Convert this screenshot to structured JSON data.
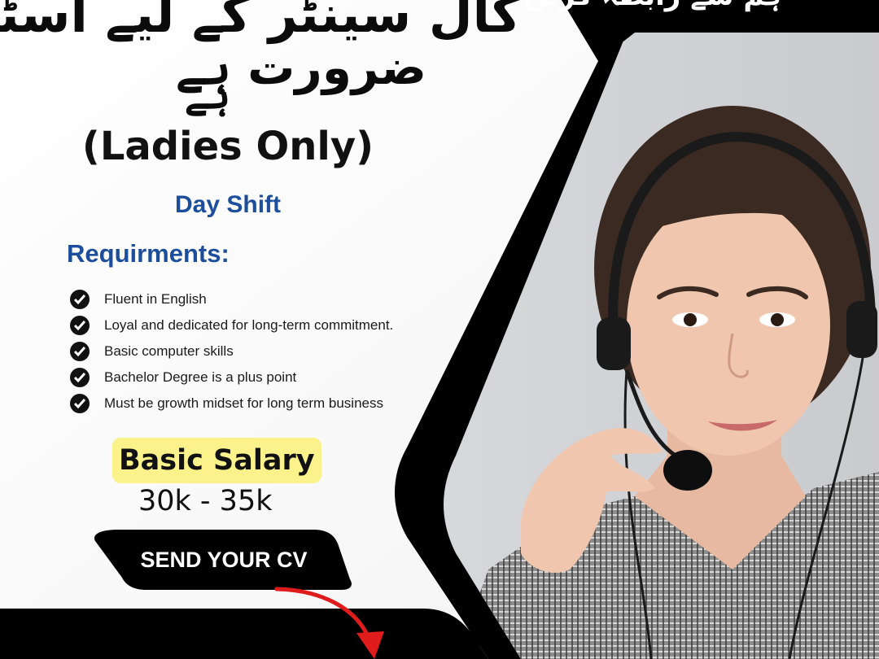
{
  "poster": {
    "urdu_headline_line1": "کال سینٹر کے لیے اسٹاف کی",
    "urdu_headline_line2": "ضرورت ہے",
    "urdu_headline_line3": "ہے",
    "urdu_top_right": "ہم سے رابطہ کریں",
    "ladies_only": "(Ladies Only)",
    "shift": "Day Shift",
    "requirements_heading": "Requirments:",
    "requirements": [
      "Fluent in English",
      "Loyal and dedicated for long-term commitment.",
      "Basic computer skills",
      "Bachelor Degree is a plus point",
      "Must be growth midset for long term business"
    ],
    "salary_label": "Basic Salary",
    "salary_range": "30k - 35k",
    "cta_label": "SEND YOUR CV"
  },
  "colors": {
    "accent_blue": "#1d4e9c",
    "salary_highlight": "#fbf28c",
    "frame_black": "#000000",
    "arrow_red": "#e01b1b"
  },
  "icons": [
    "check-circle-icon",
    "arrow-down-icon",
    "headset-icon"
  ]
}
